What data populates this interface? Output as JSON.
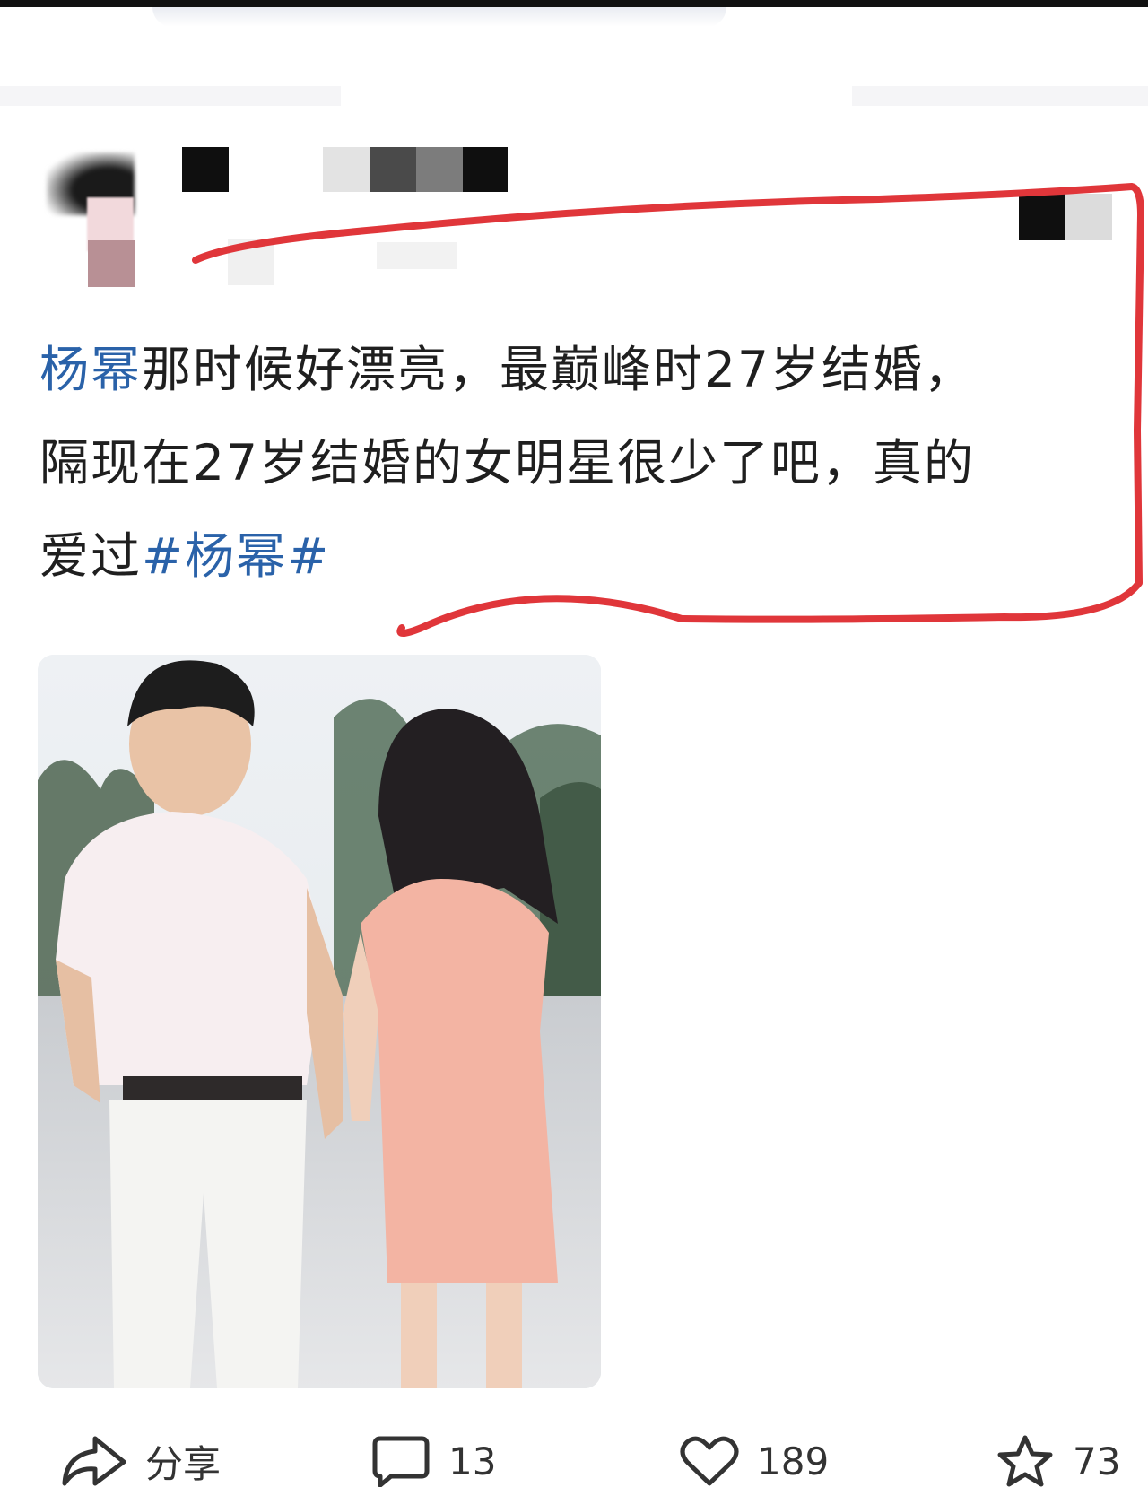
{
  "post": {
    "hashtag_name": "杨幂",
    "text_line1_rest": "那时候好漂亮，最巅峰时27岁结婚，",
    "text_line2": "隔现在27岁结婚的女明星很少了吧，真的",
    "text_line3_start": "爱过",
    "text_line3_hashtag": "#杨幂#"
  },
  "actions": {
    "share_label": "分享",
    "comment_count": "13",
    "like_count": "189",
    "favorite_count": "73"
  },
  "icons": [
    "share-icon",
    "comment-icon",
    "like-icon",
    "favorite-icon"
  ],
  "colors": {
    "link": "#2a62a9",
    "highlight_stroke": "#e0363a",
    "text": "#1f1f1f"
  }
}
